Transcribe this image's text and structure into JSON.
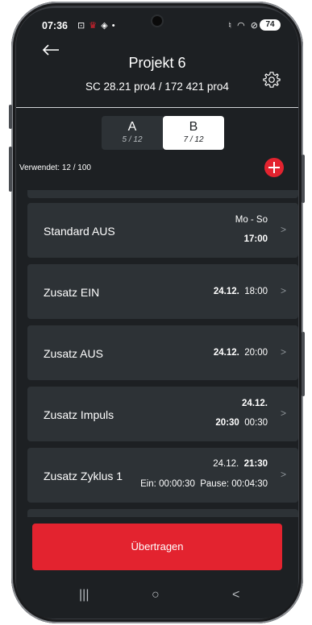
{
  "status_bar": {
    "time": "07:36",
    "left_icons": [
      "screenshot-icon",
      "app-alert-icon",
      "location-icon",
      "dot-icon"
    ],
    "right_icons": [
      "mute-icon",
      "wifi-icon",
      "dnd-icon"
    ],
    "battery": "74"
  },
  "header": {
    "title": "Projekt 6",
    "subtitle": "SC 28.21 pro4 / 172 421 pro4"
  },
  "tabs": [
    {
      "label": "A",
      "count": "5 / 12",
      "selected": false
    },
    {
      "label": "B",
      "count": "7 / 12",
      "selected": true
    }
  ],
  "used_label": "Verwendet: 12 / 100",
  "entries": [
    {
      "name": "Standard AUS",
      "days": "Mo - So",
      "time": "17:00"
    },
    {
      "name": "Zusatz EIN",
      "date": "24.12.",
      "time": "18:00"
    },
    {
      "name": "Zusatz AUS",
      "date": "24.12.",
      "time": "20:00"
    },
    {
      "name": "Zusatz Impuls",
      "date": "24.12.",
      "start": "20:30",
      "duration": "00:30"
    },
    {
      "name": "Zusatz Zyklus 1",
      "date": "24.12.",
      "time": "21:30",
      "on": "Ein: 00:00:30",
      "pause": "Pause: 00:04:30"
    }
  ],
  "submit_label": "Übertragen",
  "nav_icons": [
    "recents-icon",
    "home-icon",
    "back-nav-icon"
  ],
  "colors": {
    "accent": "#e3232f",
    "background": "#1d2023",
    "card": "#2d3236"
  }
}
